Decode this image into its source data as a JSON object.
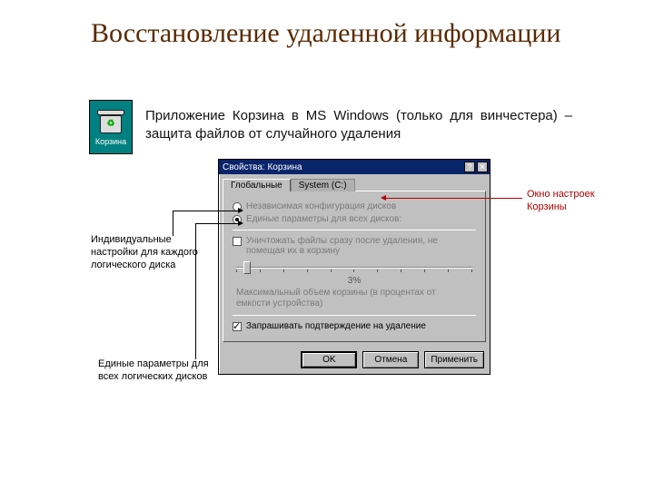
{
  "slide": {
    "title": "Восстановление удаленной информации",
    "icon_label": "Корзина",
    "description": "Приложение  Корзина    в  MS  Windows  (только  для винчестера) – защита файлов от случайного удаления"
  },
  "dialog": {
    "title": "Свойства: Корзина",
    "tabs": [
      "Глобальные",
      "System (C:)"
    ],
    "active_tab": 0,
    "radio_independent": "Независимая конфигурация дисков",
    "radio_unified": "Единые параметры для всех дисков:",
    "radio_selected": "unified",
    "check_delete_immediate": "Уничтожать файлы сразу после удаления, не помещая их в корзину",
    "check_delete_immediate_checked": false,
    "slider_percent": "3%",
    "max_label": "Максимальный объем корзины (в процентах от емкости устройства)",
    "check_confirm": "Запрашивать подтверждение на удаление",
    "check_confirm_checked": true,
    "buttons": {
      "ok": "OK",
      "cancel": "Отмена",
      "apply": "Применить"
    }
  },
  "annotations": {
    "right": "Окно настроек Корзины",
    "left1": "Индивидуальные настройки для каждого логического диска",
    "left2": "Единые параметры для всех логических дисков"
  }
}
